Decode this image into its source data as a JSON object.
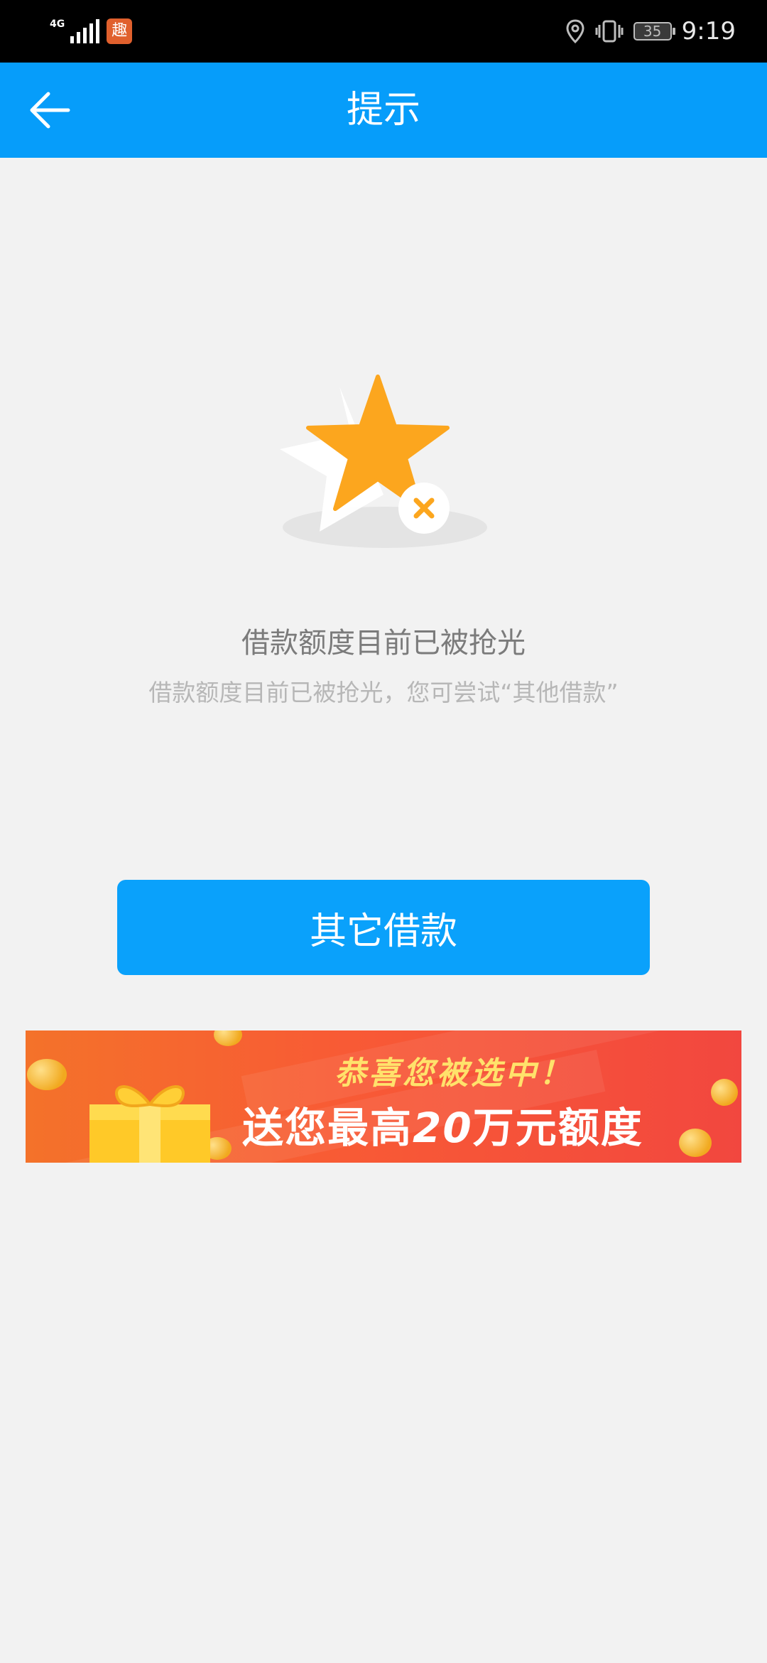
{
  "status_bar": {
    "network": "4G",
    "app_badge": "趣",
    "battery": "35",
    "time": "9:19"
  },
  "header": {
    "title": "提示"
  },
  "message": {
    "title": "借款额度目前已被抢光",
    "subtitle": "借款额度目前已被抢光，您可尝试“其他借款”"
  },
  "actions": {
    "primary_label": "其它借款"
  },
  "banner": {
    "line1": "恭喜您被选中！",
    "line2_prefix": "送您最高",
    "line2_amount": "20",
    "line2_suffix": "万元额度"
  },
  "colors": {
    "brand_blue": "#069dfa",
    "star_orange": "#fca61e",
    "banner_red": "#f2473f"
  }
}
